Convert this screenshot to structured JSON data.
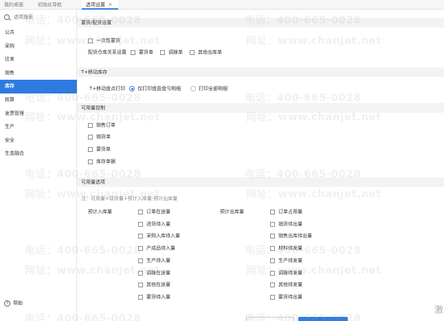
{
  "top_tabs": {
    "tab1": "我的桌面",
    "tab2": "初始化导航",
    "tab3": "选项设置",
    "close": "×"
  },
  "sidebar": {
    "search_placeholder": "选项搜索",
    "items": [
      "公共",
      "采购",
      "往来",
      "销售",
      "库存",
      "核算",
      "发票管理",
      "生产",
      "安全",
      "生态融合"
    ],
    "active_index": 4,
    "help": "帮助"
  },
  "sections": {
    "s1": {
      "title": "要货/配货设置",
      "one_time": "一次性要货",
      "warehouse_label": "配货仓库关系设置",
      "warehouse_opts": [
        "要货单",
        "调拨单",
        "其他出库单"
      ]
    },
    "s2": {
      "title": "T+移动库存",
      "print_label": "T+移动盘点打印",
      "print_opts": [
        "仅打印盘盈盘亏明细",
        "打印全部明细"
      ],
      "selected": 0
    },
    "s3": {
      "title": "可用量控制",
      "items": [
        "销售订单",
        "销货单",
        "要货单",
        "库存单据"
      ]
    },
    "s4": {
      "title": "可用量选项",
      "note": "注：可用量=现存量+预计入库量-预计出库量",
      "in_label": "预计入库量",
      "in_items": [
        "订单在途量",
        "进货待入量",
        "采购入库待入量",
        "产成品待入量",
        "生产待入量",
        "调拨在途量",
        "其他在途量",
        "要货待入量"
      ],
      "out_label": "预计出库量",
      "out_items": [
        "订单占用量",
        "销货待出量",
        "销售出库待出量",
        "材料待发量",
        "生产待发量",
        "调拨待发量",
        "其他待发量",
        "要货待出量"
      ]
    }
  },
  "watermark": {
    "phone": "电话：400-665-0028",
    "site": "网址：www.chanjet.net"
  },
  "corner_text": "激"
}
